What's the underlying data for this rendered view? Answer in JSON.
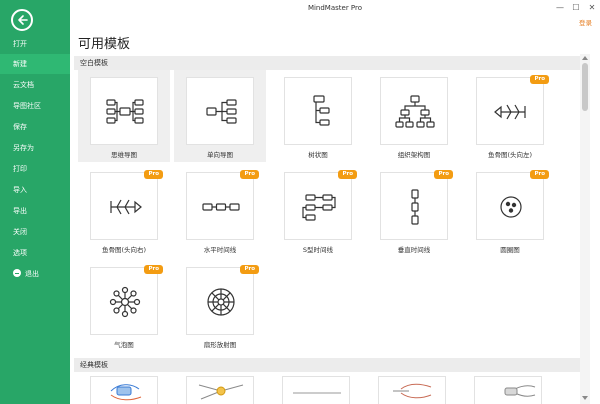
{
  "window": {
    "title": "MindMaster Pro",
    "minimize": "—",
    "maximize": "☐",
    "close": "✕"
  },
  "login_label": "登录",
  "page_title": "可用模板",
  "sidebar": {
    "back_icon": "back-arrow-icon",
    "items": [
      "打开",
      "新建",
      "云文档",
      "导图社区",
      "保存",
      "另存为",
      "打印",
      "导入",
      "导出",
      "关闭",
      "选项",
      "退出"
    ],
    "active_item": "新建"
  },
  "sections": {
    "blank": "空白模板",
    "classic": "经典模板"
  },
  "pro_badge": "Pro",
  "templates": [
    {
      "label": "思维导图",
      "icon": "mind-map-icon",
      "pro": false
    },
    {
      "label": "单向导图",
      "icon": "right-map-icon",
      "pro": false
    },
    {
      "label": "树状图",
      "icon": "tree-chart-icon",
      "pro": false
    },
    {
      "label": "组织架构图",
      "icon": "org-chart-icon",
      "pro": false
    },
    {
      "label": "鱼骨图(头向左)",
      "icon": "fishbone-left-icon",
      "pro": true
    },
    {
      "label": "鱼骨图(头向右)",
      "icon": "fishbone-right-icon",
      "pro": true
    },
    {
      "label": "水平时间线",
      "icon": "horizontal-timeline-icon",
      "pro": true
    },
    {
      "label": "S型时间线",
      "icon": "s-timeline-icon",
      "pro": true
    },
    {
      "label": "垂直时间线",
      "icon": "vertical-timeline-icon",
      "pro": true
    },
    {
      "label": "圆圈图",
      "icon": "circle-chart-icon",
      "pro": true
    },
    {
      "label": "气泡图",
      "icon": "bubble-chart-icon",
      "pro": true
    },
    {
      "label": "扇形放射图",
      "icon": "sector-radial-icon",
      "pro": true
    }
  ],
  "colors": {
    "sidebar": "#28a667",
    "sidebar_active": "#2fb873",
    "pro_badge": "#f39c12",
    "login": "#e67e22"
  }
}
